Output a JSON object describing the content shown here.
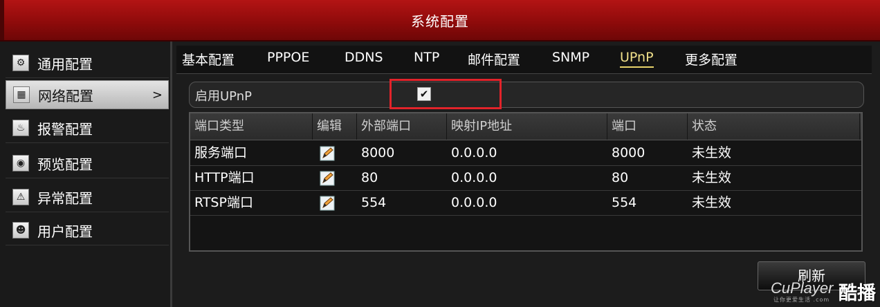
{
  "window": {
    "title": "系统配置"
  },
  "sidebar": {
    "items": [
      {
        "label": "通用配置",
        "icon": "gear-icon"
      },
      {
        "label": "网络配置",
        "icon": "network-icon",
        "active": true,
        "arrow": ">"
      },
      {
        "label": "报警配置",
        "icon": "alarm-icon"
      },
      {
        "label": "预览配置",
        "icon": "eye-icon"
      },
      {
        "label": "异常配置",
        "icon": "warning-icon"
      },
      {
        "label": "用户配置",
        "icon": "users-icon"
      }
    ]
  },
  "tabs": [
    {
      "label": "基本配置"
    },
    {
      "label": "PPPOE"
    },
    {
      "label": "DDNS"
    },
    {
      "label": "NTP"
    },
    {
      "label": "邮件配置"
    },
    {
      "label": "SNMP"
    },
    {
      "label": "UPnP",
      "active": true
    },
    {
      "label": "更多配置"
    }
  ],
  "upnp": {
    "label": "启用UPnP",
    "checked": true,
    "check_glyph": "✔"
  },
  "table": {
    "headers": [
      "端口类型",
      "编辑",
      "外部端口",
      "映射IP地址",
      "端口",
      "状态"
    ],
    "rows": [
      {
        "type": "服务端口",
        "external_port": "8000",
        "ip": "0.0.0.0",
        "port": "8000",
        "status": "未生效"
      },
      {
        "type": "HTTP端口",
        "external_port": "80",
        "ip": "0.0.0.0",
        "port": "80",
        "status": "未生效"
      },
      {
        "type": "RTSP端口",
        "external_port": "554",
        "ip": "0.0.0.0",
        "port": "554",
        "status": "未生效"
      }
    ]
  },
  "buttons": {
    "refresh": "刷新"
  },
  "watermark": {
    "en": "CuPlayer",
    "cn": "酷播",
    "small": "让你更爱生活 .com"
  },
  "colors": {
    "title_red": "#a50f0f",
    "tab_active": "#f0e08a",
    "highlight_red": "#e2232a"
  }
}
